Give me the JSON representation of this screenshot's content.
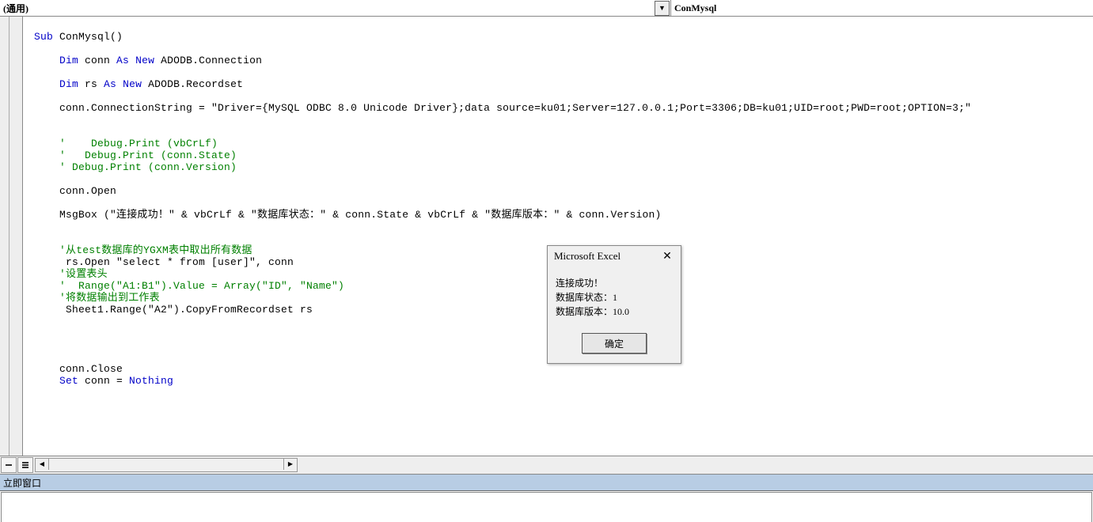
{
  "dropdowns": {
    "object": "(通用)",
    "procedure": "ConMysql"
  },
  "code": {
    "l1": {
      "a": "Sub",
      "b": " ConMysql()"
    },
    "l2": {
      "a": "Dim",
      "b": " conn ",
      "c": "As",
      "d": " ",
      "e": "New",
      "f": " ADODB.Connection"
    },
    "l3": {
      "a": "Dim",
      "b": " rs ",
      "c": "As",
      "d": " ",
      "e": "New",
      "f": " ADODB.Recordset"
    },
    "l4": "    conn.ConnectionString = \"Driver={MySQL ODBC 8.0 Unicode Driver};data source=ku01;Server=127.0.0.1;Port=3306;DB=ku01;UID=root;PWD=root;OPTION=3;\"",
    "c1": "    '    Debug.Print (vbCrLf)",
    "c2": "    '   Debug.Print (conn.State)",
    "c3": "    ' Debug.Print (conn.Version)",
    "l5": "    conn.Open",
    "l6": "    MsgBox (\"连接成功！\" & vbCrLf & \"数据库状态：\" & conn.State & vbCrLf & \"数据库版本：\" & conn.Version)",
    "c4": "    '从test数据库的YGXM表中取出所有数据",
    "l7": "     rs.Open \"select * from [user]\", conn",
    "c5": "    '设置表头",
    "c6": "    '  Range(\"A1:B1\").Value = Array(\"ID\", \"Name\")",
    "c7": "    '将数据输出到工作表",
    "l8": "     Sheet1.Range(\"A2\").CopyFromRecordset rs",
    "l9": "    conn.Close",
    "l10": {
      "a": "Set",
      "b": " conn = ",
      "c": "Nothing"
    }
  },
  "dialog": {
    "title": "Microsoft Excel",
    "line1": "连接成功！",
    "line2": "数据库状态：1",
    "line3": "数据库版本：10.0",
    "ok": "确定"
  },
  "immediate_title": "立即窗口"
}
